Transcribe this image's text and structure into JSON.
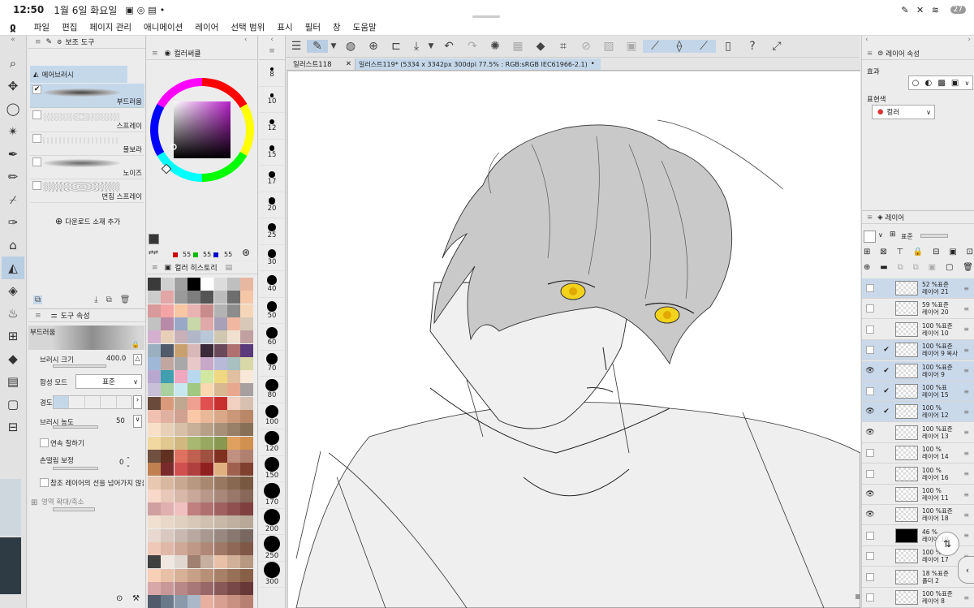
{
  "status_bar": {
    "time": "12:50",
    "date": "1월 6일 화요일",
    "battery": "27"
  },
  "menu": [
    "파일",
    "편집",
    "페이지 관리",
    "애니메이션",
    "레이어",
    "선택 범위",
    "표시",
    "필터",
    "창",
    "도움말"
  ],
  "sub_tool": {
    "title": "보조 도구",
    "group": "에어브러시",
    "brushes": [
      {
        "label": "부드러움",
        "checked": true
      },
      {
        "label": "스프레이",
        "checked": false
      },
      {
        "label": "물보라",
        "checked": false
      },
      {
        "label": "노이즈",
        "checked": false
      },
      {
        "label": "번짐 스프레이",
        "checked": false
      }
    ],
    "add_material": "다운로드 소재 추가"
  },
  "tool_property": {
    "title": "도구 속성",
    "brush_name": "부드러움",
    "size_label": "브러시 크기",
    "size_value": "400.0",
    "blend_label": "합성 모드",
    "blend_value": "표준",
    "hardness_label": "경도",
    "density_label": "브러시 농도",
    "density_value": "50",
    "continuous_label": "연속 칠하기",
    "stabilization_label": "손떨림 보정",
    "stabilization_value": "0",
    "reference_label": "참조 레이어의 선을 넘어가지 않음",
    "zoom_label": "영역 확대/축소"
  },
  "color_wheel": {
    "title": "컬러써클",
    "r": "55",
    "g": "55",
    "b": "55",
    "main_color": "#373737"
  },
  "color_history": {
    "title": "컬러 히스토리"
  },
  "brush_sizes": [
    "8",
    "10",
    "12",
    "15",
    "17",
    "20",
    "25",
    "30",
    "40",
    "50",
    "60",
    "70",
    "80",
    "100",
    "120",
    "150",
    "170",
    "200",
    "250",
    "300"
  ],
  "tabs": [
    {
      "label": "일러스트118"
    },
    {
      "label": "일러스트119* (5334 x 3342px 300dpi 77.5% : RGB:sRGB IEC61966-2.1)"
    }
  ],
  "layer_property": {
    "title": "레이어 속성",
    "effect_label": "효과",
    "expression_label": "표현색",
    "expression_value": "컬러"
  },
  "layers_panel": {
    "title": "레이어",
    "blend": "표준",
    "layers": [
      {
        "pct": "52 %표준",
        "name": "레이어 21",
        "eye": false,
        "selected": true
      },
      {
        "pct": "59 %표준",
        "name": "레이어 20",
        "eye": false,
        "selected": false
      },
      {
        "pct": "100 %표준",
        "name": "레이어 10",
        "eye": false,
        "selected": false
      },
      {
        "pct": "100 %표준",
        "name": "레이어 9 복사",
        "eye": false,
        "selected": true
      },
      {
        "pct": "100 %표준",
        "name": "레이어 9",
        "eye": true,
        "selected": true
      },
      {
        "pct": "100 %표",
        "name": "레이어 15",
        "eye": false,
        "selected": true
      },
      {
        "pct": "100 %",
        "name": "레이어 12",
        "eye": true,
        "selected": true
      },
      {
        "pct": "100 %표준",
        "name": "레이어 13",
        "eye": true,
        "selected": false
      },
      {
        "pct": "100 %",
        "name": "레이어 14",
        "eye": false,
        "selected": false
      },
      {
        "pct": "100 %",
        "name": "레이어 16",
        "eye": false,
        "selected": false
      },
      {
        "pct": "100 %",
        "name": "레이어 11",
        "eye": true,
        "selected": false
      },
      {
        "pct": "100 %표준",
        "name": "레이어 18",
        "eye": true,
        "selected": false
      },
      {
        "pct": "46 %",
        "name": "레이어 19",
        "eye": false,
        "selected": false
      },
      {
        "pct": "100 %",
        "name": "레이어 17",
        "eye": false,
        "selected": false
      },
      {
        "pct": "18 %표준",
        "name": "폴더 2",
        "eye": false,
        "selected": false
      },
      {
        "pct": "100 %표준",
        "name": "레이어 8",
        "eye": false,
        "selected": false
      }
    ]
  }
}
